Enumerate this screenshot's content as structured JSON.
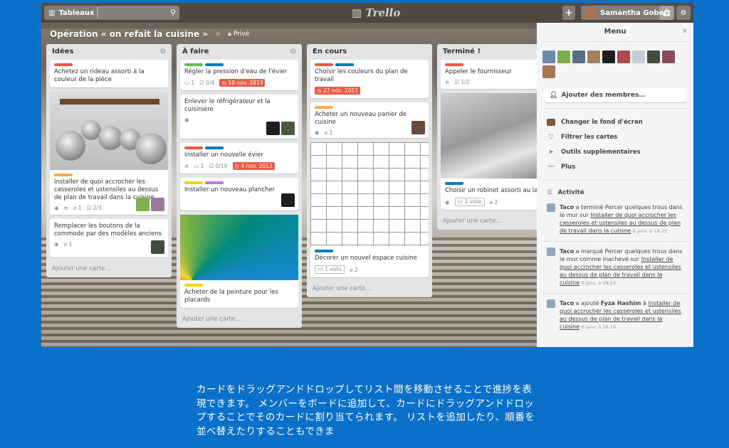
{
  "topbar": {
    "boards_label": "Tableaux",
    "logo": "Trello",
    "user_name": "Samantha Gobert"
  },
  "board": {
    "title": "Opération « on refait la cuisine »",
    "privacy": "Privé"
  },
  "lists": [
    {
      "title": "Idées",
      "add": "Ajouter une carte...",
      "cards": [
        {
          "title": "Achetez un rideau assorti à la couleur de la pièce"
        },
        {
          "title": "Installer de quoi accrocher les casseroles et ustensiles au dessus de plan de travail dans la cuisine",
          "checklist": "2/3",
          "attach": "1"
        },
        {
          "title": "Remplacer les boutons de la commode par des modèles anciens",
          "attach": "1"
        }
      ]
    },
    {
      "title": "À faire",
      "add": "Ajouter une carte...",
      "cards": [
        {
          "title": "Régler la pression d'eau de l'évier",
          "comments": "1",
          "checklist": "0/4",
          "due": "10 nov. 2013"
        },
        {
          "title": "Enlever le réfrigérateur et la cuisinière"
        },
        {
          "title": "Installer un nouvelle évier",
          "comments": "1",
          "checklist": "0/10",
          "due": "4 nov. 2013"
        },
        {
          "title": "Installer un nouveau plancher"
        },
        {
          "title": "Acheter de la peinture pour les placards"
        }
      ]
    },
    {
      "title": "En cours",
      "add": "Ajouter une carte...",
      "cards": [
        {
          "title": "Choisir les couleurs du plan de travail",
          "due": "27 nov. 2013"
        },
        {
          "title": "Acheter un nouveau panier de cuisine",
          "attach": "1"
        },
        {
          "title": "Décorer un nouvel espace cuisine",
          "vote": "1 voto",
          "attach": "2"
        }
      ]
    },
    {
      "title": "Terminé !",
      "add": "Ajouter une carte...",
      "cards": [
        {
          "title": "Appeler le fournisseur",
          "checklist": "1/2"
        },
        {
          "title": "Choisir un robinet assorti au lavabo",
          "vote": "1 vote",
          "attach": "2"
        }
      ]
    }
  ],
  "menu": {
    "title": "Menu",
    "add_members": "Ajouter des membres…",
    "items": [
      "Changer le fond d'écran",
      "Filtrer les cartes",
      "Outils supplémentaires",
      "Plus"
    ],
    "activity_title": "Activité",
    "activity": [
      {
        "who": "Taco",
        "t1": " a terminé Percer quelques trous dans le mur sur ",
        "link": "Installer de quoi accrocher les casseroles et ustensiles au dessus de plan de travail dans la cuisine",
        "time": "6 janv. à 18:23"
      },
      {
        "who": "Taco",
        "t1": " a marqué Percer quelques trous dans le mur comme inachevé sur ",
        "link": "Installer de quoi accrocher les casseroles et ustensiles au dessus de plan de travail dans la cuisine",
        "time": "6 janv. à 18:23"
      },
      {
        "who": "Taco",
        "t1": " a ajouté ",
        "who2": "Fyza Hashim",
        "t2": " à ",
        "link": "Installer de quoi accrocher les casseroles et ustensiles au dessus de plan de travail dans la cuisine",
        "time": "6 janv. à 18:19"
      }
    ]
  },
  "caption": "カードをドラッグアンドドロップしてリスト間を移動させることで進捗を表現できます。 メンバーをボードに追加して、カードにドラッグアンドドロップすることでそのカードに割り当てられます。 リストを追加したり、順番を並べ替えたりすることもできま",
  "colors": {
    "green": "#61bd4f",
    "yellow": "#f2d600",
    "orange": "#ffab4a",
    "red": "#eb5a46",
    "purple": "#c377e0",
    "blue": "#0079bf"
  }
}
